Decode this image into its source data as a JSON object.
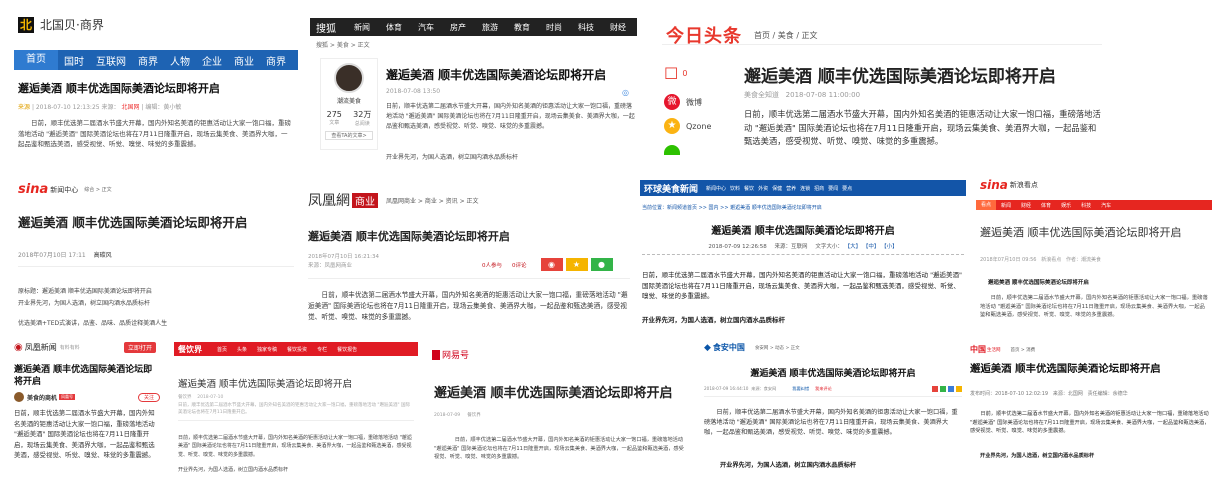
{
  "headline": "邂逅美酒 顺丰优选国际美酒论坛即将开启",
  "ifeng_headline": "邂逅美酒 顺丰优选国际美酒论坛即将开启",
  "body_long": "日前，顺丰优选第二届酒水节盛大开幕，国内外知名美酒的钜惠活动让大家一饱口福，重磅落地活动 \"邂逅美酒\" 国际美酒论坛也将在7月11日隆重开启，现场云集美食、美酒界大咖，一起品鉴和甄选美酒，感受视觉、听觉、嗅觉、味觉的多重震撼。",
  "bold_line": "开业界先河，为国人选酒，树立国内酒水品质标杆",
  "plain_line": "开业界先河，为国人选酒，树立国内酒水品质标杆",
  "brand_colors": {
    "beiguo_blue": "#1e63b3",
    "sohu_dark": "#222222",
    "toutiao_red": "#e8382d",
    "ifeng_red": "#c3151c",
    "huanqiu_blue": "#1355a8",
    "sina_red": "#e62620",
    "cy_red": "#e01b24",
    "wangyi_red": "#d0021b"
  },
  "beiguo": {
    "logo_icon": "beiguo-logo-icon",
    "logo_text": "北国贝·商界",
    "nav": [
      "首页",
      "国时",
      "互联网",
      "商界",
      "人物",
      "企业",
      "商业",
      "商界",
      "创业"
    ],
    "meta_left": "来源",
    "meta_time": "| 2018-07-10 12:13:25",
    "meta_author": "来源：",
    "meta_source": "北国网",
    "meta_editor": "| 编辑：黄小敏"
  },
  "sohu": {
    "logo_text": "搜狐",
    "nav": [
      "新闻",
      "体育",
      "汽车",
      "房产",
      "旅游",
      "教育",
      "时尚",
      "科技",
      "财经"
    ],
    "breadcrumb": "搜狐 > 美食 > 正文",
    "author_name": "潮流美食",
    "stat1_value": "275",
    "stat1_label": "文章",
    "stat2_value": "32万",
    "stat2_label": "总阅读",
    "more_link": "查看TA的文章>",
    "date": "2018-07-08 13:50",
    "share_icon": "share-icon"
  },
  "toutiao": {
    "logo_text": "今日头条",
    "breadcrumb": "首页 / 美食 / 正文",
    "comment_count": "0",
    "share_items": [
      "微博",
      "Qzone"
    ],
    "meta": "美食全知道   2018-07-08 11:00:00"
  },
  "sina_news": {
    "logo_text": "sina",
    "logo_sub": "新闻中心",
    "breadcrumb": "综合 > 正文",
    "meta_time": "2018年07月10日 17:11",
    "meta_source": "高碳风",
    "p1": "原标题：邂逅美酒 顺丰优选国际美酒论坛即将开启",
    "p2": "开业界先河，为国人选酒，树立国内酒水品质标杆",
    "p3": "优选美酒+TED式演讲，品鉴、品味、品质诠释美酒人生"
  },
  "ifeng_biz": {
    "logo_text": "凤凰網",
    "logo_tag": "商业",
    "breadcrumb": "凤凰网商业 > 商业 > 资讯 > 正文",
    "meta_time": "2018年07月10日 16:21:34",
    "meta_source": "来源：凤凰网商业",
    "likes": "0人参与",
    "comments": "0评论"
  },
  "huanqiu": {
    "logo_text": "环球美食新闻",
    "nav": [
      "新闻中心",
      "饮料",
      "餐饮",
      "外资",
      "保健",
      "营养",
      "连锁",
      "招商",
      "要闻",
      "要点"
    ],
    "breadcrumb": "当前位置：新闻频道首页 >> 国内 >> 邂逅美酒 顺丰优选国际美酒论坛即将开启",
    "meta_time": "2018-07-09 12:26:58",
    "meta_source": "来源：互联网",
    "font_label": "文字大小：",
    "font_sizes": [
      "【大】",
      "【中】",
      "【小】"
    ]
  },
  "sina_focus": {
    "logo_text": "sina",
    "logo_sub": "新浪看点",
    "nav": [
      "看点",
      "新闻",
      "财经",
      "体育",
      "娱乐",
      "科技",
      "汽车"
    ],
    "meta": "2018年07月10日 09:56   新浪看点   作者：潮流美食",
    "intro": "邂逅美酒 顺丰优选国际美酒论坛即将开启"
  },
  "ifeng_news": {
    "logo_text": "凤凰新闻",
    "logo_sub": "有料有料",
    "open_button": "立即打开",
    "author_name": "美食的商机",
    "author_badge": "凤凰号",
    "follow_button": "关注"
  },
  "canyin": {
    "logo_text": "餐饮界",
    "nav": [
      "首页",
      "头条",
      "独家专稿",
      "餐饮投资",
      "专栏",
      "餐饮报告"
    ],
    "meta": "餐饮界    2018-07-10",
    "sub": "日前，顺丰优选第二届酒水节盛大开幕，国内外知名美酒的钜惠活动让大家一饱口福，重磅落地活动 \"邂逅美酒\" 国际美酒论坛也将在7月11日隆重开启。"
  },
  "wangyi": {
    "logo_text": "网易号",
    "meta": "2018-07-09     餐饮界"
  },
  "shian": {
    "logo_text": "食安中国",
    "breadcrumb": "食安网 > 动态 > 正文",
    "meta": "2018-07-09 16:44:10  来源：食安网",
    "links": [
      "我要纠错",
      "我来评论"
    ]
  },
  "zgsc": {
    "logo_text": "中国",
    "logo_sub": "生活网",
    "breadcrumb": "首页 > 消费",
    "meta": "发布时间：2018-07-10 12:02:19   来源：北国网   责任编辑：余德华"
  }
}
